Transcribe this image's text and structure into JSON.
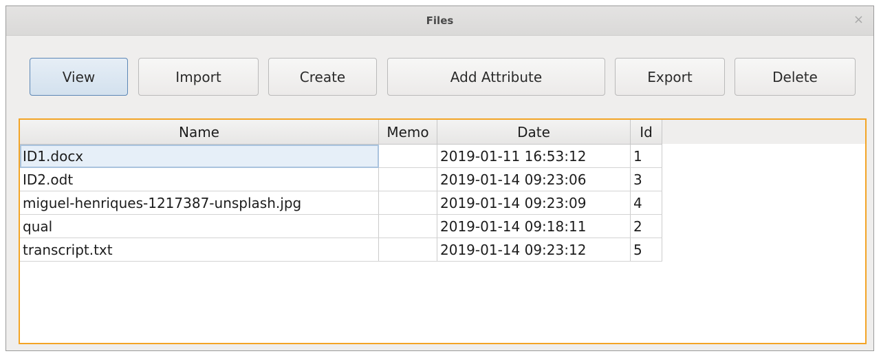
{
  "window": {
    "title": "Files",
    "close_glyph": "×"
  },
  "toolbar": {
    "view": "View",
    "import": "Import",
    "create": "Create",
    "add_attribute": "Add Attribute",
    "export": "Export",
    "delete": "Delete"
  },
  "table": {
    "headers": {
      "name": "Name",
      "memo": "Memo",
      "date": "Date",
      "id": "Id"
    },
    "rows": [
      {
        "name": "ID1.docx",
        "memo": "",
        "date": "2019-01-11 16:53:12",
        "id": "1"
      },
      {
        "name": "ID2.odt",
        "memo": "",
        "date": "2019-01-14 09:23:06",
        "id": "3"
      },
      {
        "name": "miguel-henriques-1217387-unsplash.jpg",
        "memo": "",
        "date": "2019-01-14 09:23:09",
        "id": "4"
      },
      {
        "name": "qual",
        "memo": "",
        "date": "2019-01-14 09:18:11",
        "id": "2"
      },
      {
        "name": "transcript.txt",
        "memo": "",
        "date": "2019-01-14 09:23:12",
        "id": "5"
      }
    ]
  },
  "colors": {
    "frame_border": "#f3a425",
    "selected_cell": "#e6eff8",
    "active_button_border": "#5b86b5"
  }
}
